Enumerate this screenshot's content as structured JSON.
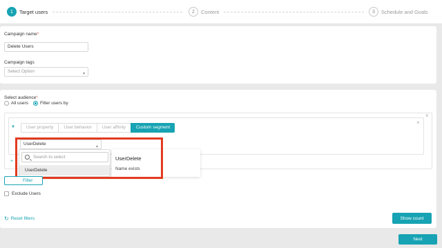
{
  "stepper": {
    "steps": [
      {
        "num": "1",
        "label": "Target users"
      },
      {
        "num": "2",
        "label": "Content"
      },
      {
        "num": "3",
        "label": "Schedule and Goals"
      }
    ]
  },
  "campaign": {
    "name_label": "Campaign name",
    "required_mark": "*",
    "name_value": "Delete Users",
    "tags_label": "Campaign tags",
    "tags_placeholder": "Select Option"
  },
  "audience": {
    "label": "Select audience",
    "required_mark": "*",
    "radio_all": "All users",
    "radio_filter": "Filter users by",
    "tabs": [
      "User property",
      "User behavior",
      "User affinity",
      "Custom segment"
    ],
    "segment_value": "UserDelete",
    "search_placeholder": "Search to select",
    "option": "UserDelete",
    "info_title": "UserDelete",
    "info_sub": "Name exists",
    "filter_button": "Filter",
    "exclude_label": "Exclude Users",
    "reset_label": "Reset filters",
    "show_count_label": "Show count"
  },
  "footer": {
    "next_label": "Next"
  },
  "colors": {
    "accent": "#17a3b3",
    "highlight": "#e23a1f"
  },
  "icons": {
    "close": "close-icon",
    "caret": "caret-down-icon",
    "search": "search-icon",
    "reset": "refresh-icon",
    "plus": "plus-icon"
  }
}
